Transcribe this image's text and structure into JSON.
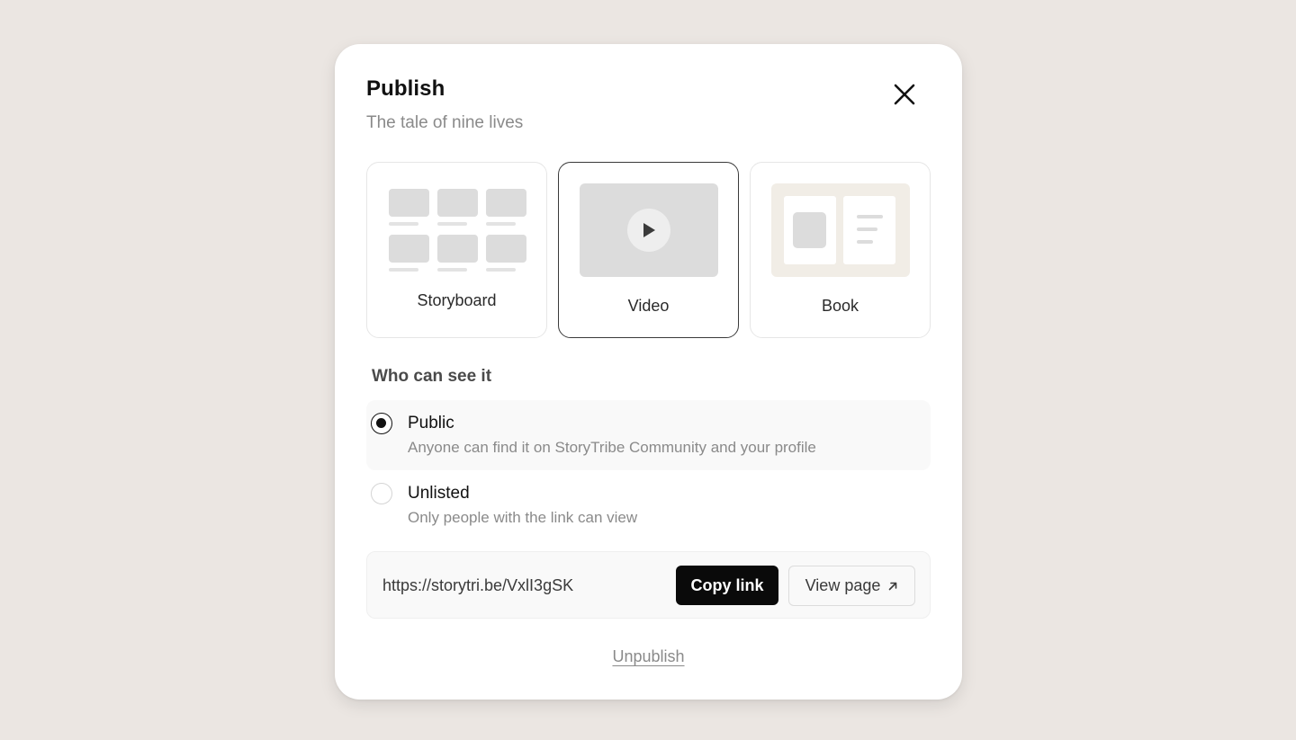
{
  "dialog": {
    "title": "Publish",
    "subtitle": "The tale of nine lives"
  },
  "formats": {
    "selected": "Video",
    "items": [
      {
        "label": "Storyboard",
        "icon": "storyboard-grid-icon"
      },
      {
        "label": "Video",
        "icon": "play-icon"
      },
      {
        "label": "Book",
        "icon": "book-spread-icon"
      }
    ]
  },
  "visibility": {
    "label": "Who can see it",
    "selected": "Public",
    "options": [
      {
        "title": "Public",
        "description": "Anyone can find it on StoryTribe Community and your profile",
        "checked": true
      },
      {
        "title": "Unlisted",
        "description": "Only people with the link can view",
        "checked": false
      }
    ]
  },
  "share": {
    "url": "https://storytri.be/VxlI3gSK",
    "copy_label": "Copy link",
    "view_label": "View page",
    "view_icon": "external-arrow-icon"
  },
  "unpublish_label": "Unpublish",
  "colors": {
    "backdrop": "#ebe6e2",
    "primary_button": "#0a0a0a",
    "book_thumb": "#f1ede6"
  }
}
